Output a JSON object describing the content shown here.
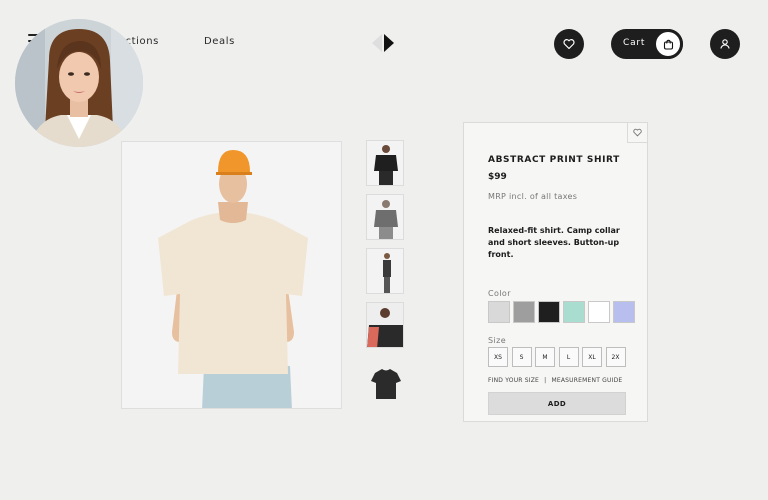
{
  "nav": {
    "collections": "llections",
    "deals": "Deals"
  },
  "header": {
    "cart_label": "Cart",
    "icons": {
      "menu": "hamburger-menu-icon",
      "logo": "brand-logo",
      "wishlist": "heart-icon",
      "cart": "shopping-bag-icon",
      "account": "user-icon"
    }
  },
  "gallery": {
    "thumbnail_count": 5
  },
  "product": {
    "title": "ABSTRACT PRINT SHIRT",
    "price": "$99",
    "tax_note": "MRP incl. of all taxes",
    "description": "Relaxed-fit shirt. Camp collar and short sleeves. Button-up front.",
    "color_label": "Color",
    "colors": [
      "#d9d9d9",
      "#9e9e9e",
      "#1f1f1f",
      "#a8ddd0",
      "#ffffff",
      "#b8bfee"
    ],
    "size_label": "Size",
    "sizes": [
      "XS",
      "S",
      "M",
      "L",
      "XL",
      "2X"
    ],
    "find_size": "FIND YOUR SIZE",
    "separator": "|",
    "measurement_guide": "MEASUREMENT GUIDE",
    "add_label": "ADD"
  },
  "colors": {
    "background": "#efefee",
    "button_dark": "#1e1e1e",
    "cap_orange": "#f0962a",
    "tshirt": "#f1e6d3"
  }
}
